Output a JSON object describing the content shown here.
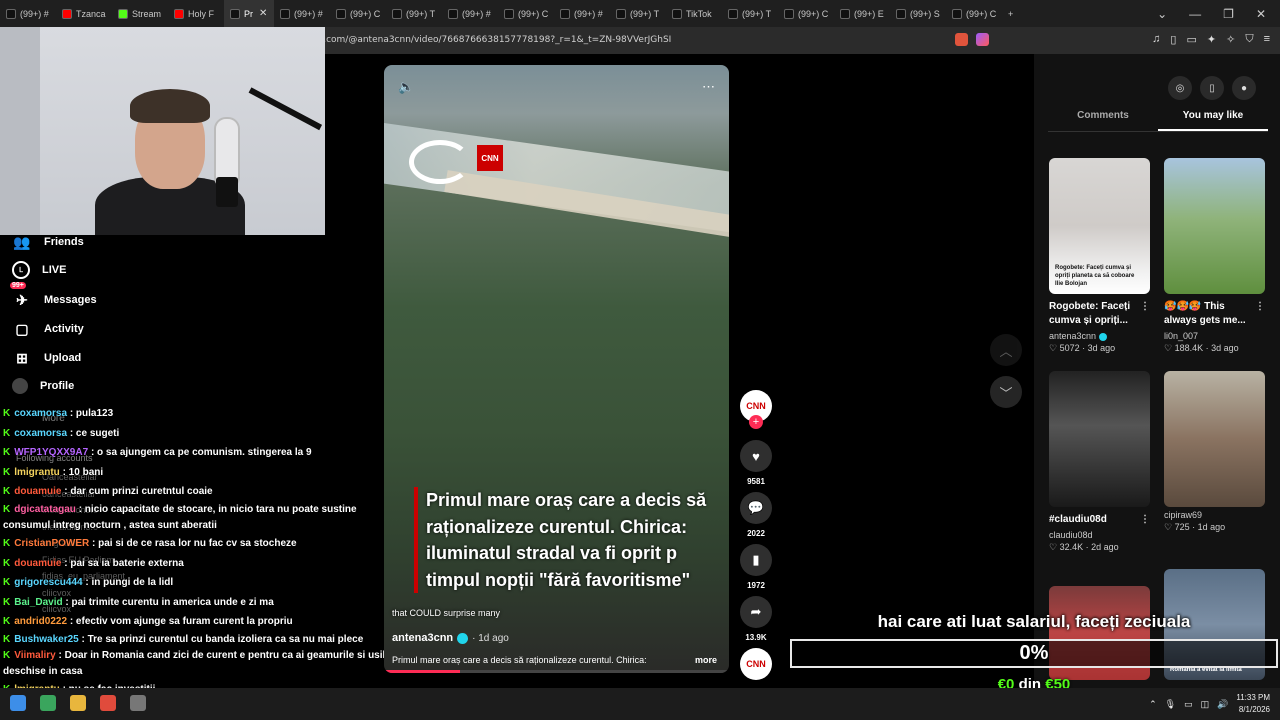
{
  "browser": {
    "tabs": [
      {
        "label": "(99+) #",
        "icon": "tiktok-icon",
        "active": false
      },
      {
        "label": "Tzanca",
        "icon": "youtube-icon",
        "active": false
      },
      {
        "label": "Stream",
        "icon": "kick-icon",
        "active": false
      },
      {
        "label": "Holy F",
        "icon": "youtube-icon",
        "active": false
      },
      {
        "label": "Pr",
        "icon": "tiktok-icon",
        "active": true
      },
      {
        "label": "(99+) #",
        "icon": "tiktok-icon",
        "active": false
      },
      {
        "label": "(99+) C",
        "icon": "tiktok-icon",
        "active": false
      },
      {
        "label": "(99+) T",
        "icon": "tiktok-icon",
        "active": false
      },
      {
        "label": "(99+) #",
        "icon": "tiktok-icon",
        "active": false
      },
      {
        "label": "(99+) C",
        "icon": "tiktok-icon",
        "active": false
      },
      {
        "label": "(99+) #",
        "icon": "tiktok-icon",
        "active": false
      },
      {
        "label": "(99+) T",
        "icon": "tiktok-icon",
        "active": false
      },
      {
        "label": "TikTok",
        "icon": "tiktok-icon",
        "active": false
      },
      {
        "label": "(99+) T",
        "icon": "tiktok-icon",
        "active": false
      },
      {
        "label": "(99+) C",
        "icon": "tiktok-icon",
        "active": false
      },
      {
        "label": "(99+) E",
        "icon": "tiktok-icon",
        "active": false
      },
      {
        "label": "(99+) S",
        "icon": "tiktok-icon",
        "active": false
      },
      {
        "label": "(99+) C",
        "icon": "tiktok-icon",
        "active": false
      }
    ],
    "new_tab": "+",
    "url": "k.com/@antena3cnn/video/7668766638157778198?_r=1&_t=ZN-98VVerJGhSI"
  },
  "nav": {
    "friends": "Friends",
    "live": "LIVE",
    "messages": "Messages",
    "messages_badge": "99+",
    "activity": "Activity",
    "upload": "Upload",
    "profile": "Profile",
    "more": "More",
    "following_accounts": "Following accounts"
  },
  "chat": [
    {
      "user": "coxamorsa",
      "color": "#5ad7ff",
      "text": ": pula123"
    },
    {
      "user": "coxamorsa",
      "color": "#5ad7ff",
      "text": ": ce sugeti"
    },
    {
      "user": "WFP1YQXX9A7",
      "color": "#b565ff",
      "text": ": o sa ajungem ca pe comunism. stingerea la 9"
    },
    {
      "user": "lmigrantu",
      "color": "#f4d35e",
      "text": ": 10 bani"
    },
    {
      "user": "douamuie",
      "color": "#ff5a3c",
      "text": ": dar cum prinzi curetntul coaie"
    },
    {
      "user": "dgicatatagau",
      "color": "#ff5fa2",
      "text": ": nicio capacitate de stocare, in nicio tara nu poate sustine consumul intreg nocturn , astea sunt aberatii"
    },
    {
      "user": "CristianPOWER",
      "color": "#ff7a3c",
      "text": ": pai si de ce rasa lor nu fac cv sa stocheze"
    },
    {
      "user": "douamuie",
      "color": "#ff5a3c",
      "text": ": pai sa ia baterie externa"
    },
    {
      "user": "grigorescu444",
      "color": "#5ad7ff",
      "text": ": in pungi de la lidl"
    },
    {
      "user": "Bai_David",
      "color": "#5cf28c",
      "text": ": pai trimite curentu in america unde e zi ma"
    },
    {
      "user": "andrid0222",
      "color": "#ff9b3c",
      "text": ": efectiv vom ajunge sa furam curent la propriu"
    },
    {
      "user": "Bushwaker25",
      "color": "#5ad7ff",
      "text": ": Tre sa prinzi curentul cu banda izoliera ca sa nu mai plece"
    },
    {
      "user": "Viimaliry",
      "color": "#ff5a3c",
      "text": ": Doar in Romania cand zici de curent e pentru ca ai geamurile si usile deschise in casa"
    },
    {
      "user": "lmigrantu",
      "color": "#f4d35e",
      "text": ": nu se fac investiții"
    }
  ],
  "ghost_following": [
    "Oanceasteliar",
    "oanceasteliar",
    "thebaldlion3.0",
    "thebaldlion3.0",
    "imigrantu",
    "Fidias EU Parliam...",
    "fidias_eu_parliament",
    "cliicvox",
    "cliicvox"
  ],
  "video": {
    "channel_logo_text": "CNN",
    "headline": "Primul mare oraș care a decis să raționalizeze curentul. Chirica: iluminatul stradal va fi oprit p timpul nopții \"fără favoritisme\"",
    "caption_overlay": "that COULD surprise many",
    "author": "antena3cnn",
    "time": "1d ago",
    "description": "Primul mare oraș care a decis să raționalizeze curentul. Chirica:",
    "more": "more",
    "progress": 0.22,
    "mute_icon": "speaker-icon",
    "menu_icon": "more-icon"
  },
  "actions": {
    "likes": "9581",
    "comments": "2022",
    "saves": "1972",
    "shares": "13.9K",
    "avatar_text": "CNN"
  },
  "right_panel": {
    "tab_comments": "Comments",
    "tab_you_may_like": "You may like",
    "cards": [
      {
        "title": "Rogobete: Faceți cumva și opriți...",
        "author": "antena3cnn",
        "verified": true,
        "likes": "5072",
        "time": "3d ago",
        "thumb_caption": "Rogobete: Faceți cumva și opriți planeta ca să coboare Ilie Bolojan"
      },
      {
        "title": "🥵🥵🥵 This always gets me...",
        "author": "li0n_007",
        "verified": false,
        "likes": "188.4K",
        "time": "3d ago",
        "thumb_caption": ""
      },
      {
        "title": "#claudiu08d",
        "author": "claudiu08d",
        "verified": false,
        "likes": "32.4K",
        "time": "2d ago",
        "thumb_caption": ""
      },
      {
        "title": "",
        "author": "cipiraw69",
        "verified": false,
        "likes": "725",
        "time": "1d ago",
        "thumb_caption": ""
      },
      {
        "title": "",
        "author": "",
        "verified": false,
        "likes": "",
        "time": "",
        "thumb_caption": ""
      },
      {
        "title": "",
        "author": "",
        "verified": false,
        "likes": "",
        "time": "",
        "thumb_caption": "România a evitat la limită"
      }
    ]
  },
  "overlay": {
    "goal_text": "hai care ati luat salariul, faceți zeciuala",
    "percent": "0%",
    "current": "€0",
    "of": "din",
    "target": "€50"
  },
  "taskbar": {
    "time": "11:33 PM",
    "date": "8/1/2026"
  },
  "colors": {
    "kick_green": "#53fc18",
    "tiktok_red": "#fe2c55",
    "cnn_red": "#cc0000"
  }
}
